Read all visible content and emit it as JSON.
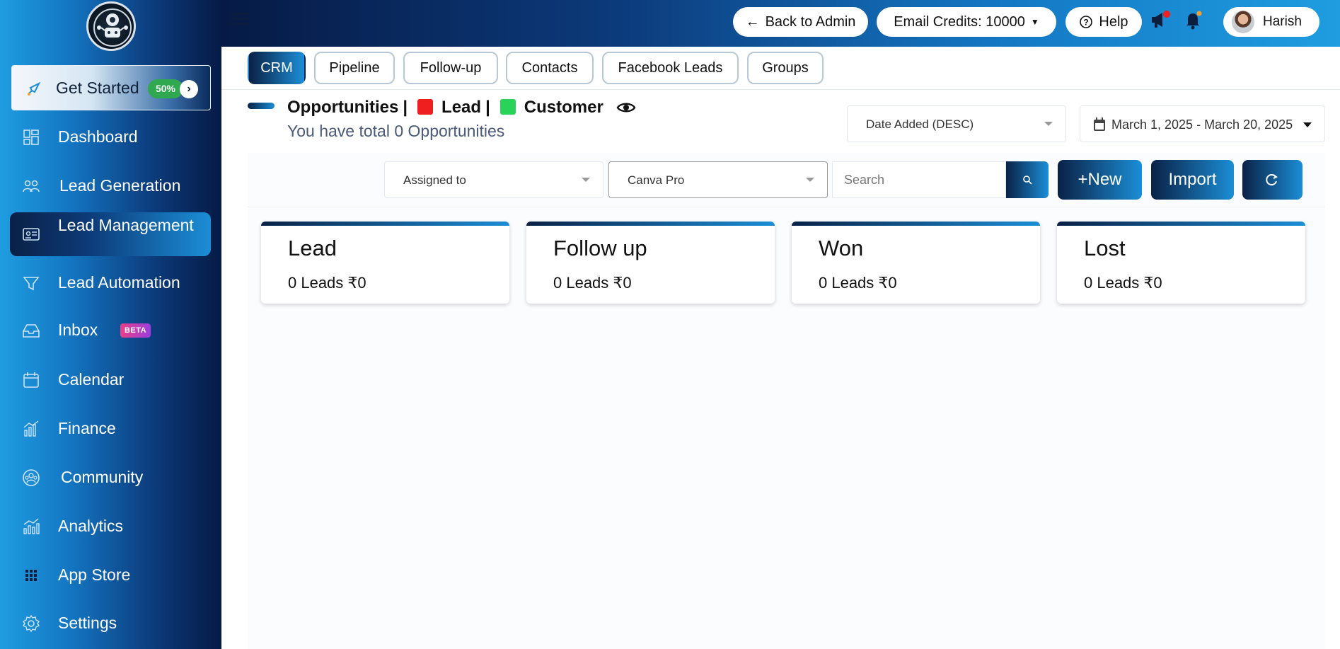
{
  "sidebar": {
    "get_started": {
      "label": "Get Started",
      "progress": "50%"
    },
    "items": [
      {
        "label": "Dashboard",
        "icon": "dashboard-icon"
      },
      {
        "label": "Lead Generation",
        "icon": "users-icon"
      },
      {
        "label": "Lead Management",
        "icon": "id-card-icon",
        "active": true
      },
      {
        "label": "Lead Automation",
        "icon": "funnel-icon"
      },
      {
        "label": "Inbox",
        "icon": "inbox-icon",
        "badge": "BETA"
      },
      {
        "label": "Calendar",
        "icon": "calendar-icon"
      },
      {
        "label": "Finance",
        "icon": "finance-icon"
      },
      {
        "label": "Community",
        "icon": "community-icon"
      },
      {
        "label": "Analytics",
        "icon": "analytics-icon"
      },
      {
        "label": "App Store",
        "icon": "grid-icon"
      },
      {
        "label": "Settings",
        "icon": "gear-icon"
      }
    ]
  },
  "header": {
    "back_label": "Back to Admin",
    "email_credits": "Email Credits: 10000",
    "help_label": "Help",
    "user_name": "Harish"
  },
  "tabs": [
    "CRM",
    "Pipeline",
    "Follow-up",
    "Contacts",
    "Facebook Leads",
    "Groups"
  ],
  "active_tab": "CRM",
  "opportunities": {
    "title": "Opportunities",
    "legend_lead": "Lead",
    "legend_customer": "Customer",
    "subtitle": "You have total 0 Opportunities"
  },
  "filters": {
    "sort": "Date Added (DESC)",
    "date_range": "March 1, 2025 - March 20, 2025",
    "assigned": "Assigned to",
    "product": "Canva Pro",
    "search_placeholder": "Search",
    "new_label": "New",
    "import_label": "Import"
  },
  "stages": [
    {
      "title": "Lead",
      "stats": "0 Leads ₹0"
    },
    {
      "title": "Follow up",
      "stats": "0 Leads ₹0"
    },
    {
      "title": "Won",
      "stats": "0 Leads ₹0"
    },
    {
      "title": "Lost",
      "stats": "0 Leads ₹0"
    }
  ],
  "colors": {
    "accent_dark": "#0a2146",
    "accent_light": "#1b8ed6",
    "lead_color": "#f01f1f",
    "customer_color": "#29d35a",
    "progress_badge": "#2fa84f"
  }
}
